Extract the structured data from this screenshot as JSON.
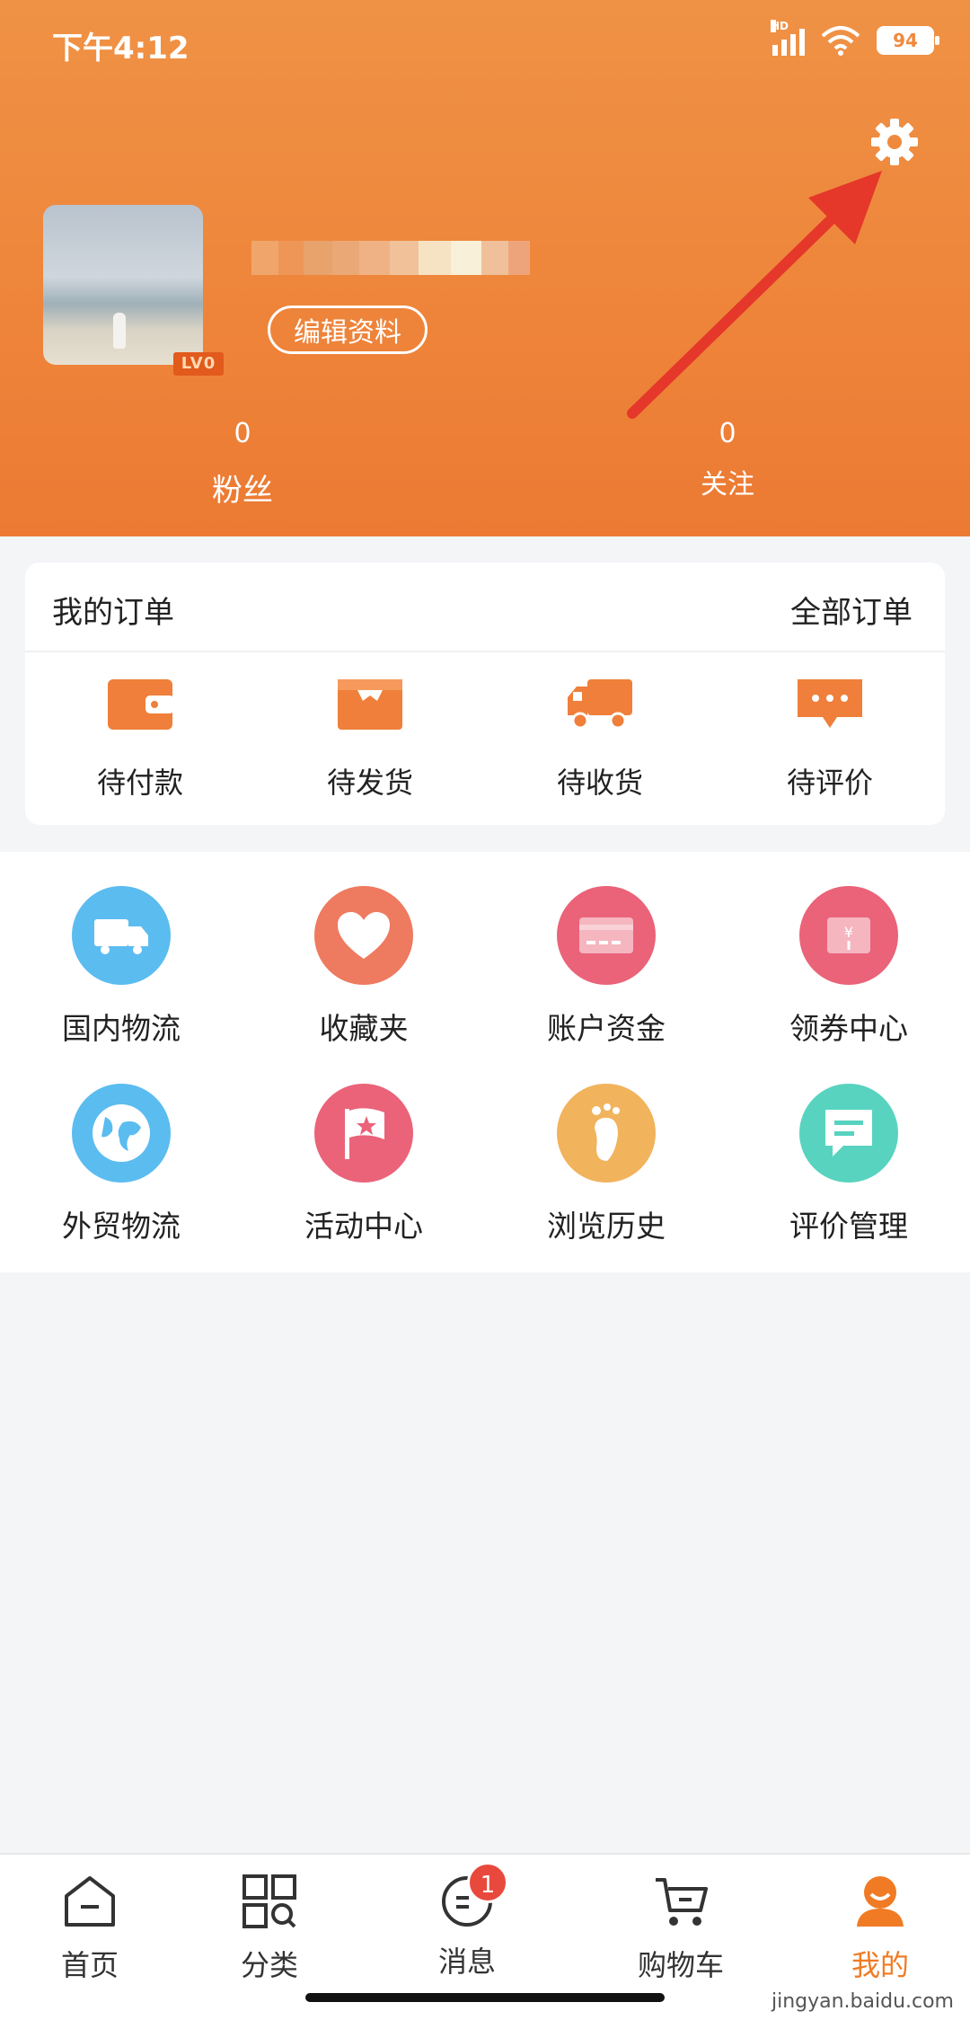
{
  "status_bar": {
    "time": "下午4:12",
    "network": "HD",
    "battery": "94"
  },
  "profile": {
    "edit_label": "编辑资料",
    "level": "LV0"
  },
  "stats": {
    "fans": {
      "count": "0",
      "label": "粉丝"
    },
    "follow": {
      "count": "0",
      "label": "关注"
    }
  },
  "orders": {
    "title": "我的订单",
    "all_label": "全部订单",
    "items": [
      {
        "label": "待付款",
        "icon": "wallet-icon"
      },
      {
        "label": "待发货",
        "icon": "box-icon"
      },
      {
        "label": "待收货",
        "icon": "truck-icon"
      },
      {
        "label": "待评价",
        "icon": "comment-icon"
      }
    ]
  },
  "services": [
    {
      "label": "国内物流",
      "icon": "truck-icon",
      "color": "#5bbcf0"
    },
    {
      "label": "收藏夹",
      "icon": "heart-icon",
      "color": "#ee7a5f"
    },
    {
      "label": "账户资金",
      "icon": "card-icon",
      "color": "#ea6379"
    },
    {
      "label": "领券中心",
      "icon": "coupon-icon",
      "color": "#ea6379"
    },
    {
      "label": "外贸物流",
      "icon": "globe-icon",
      "color": "#5bbcf0"
    },
    {
      "label": "活动中心",
      "icon": "flag-icon",
      "color": "#ea6379"
    },
    {
      "label": "浏览历史",
      "icon": "footprint-icon",
      "color": "#f1b35c"
    },
    {
      "label": "评价管理",
      "icon": "message-icon",
      "color": "#58d3bf"
    }
  ],
  "nav": {
    "items": [
      {
        "label": "首页",
        "icon": "home-icon"
      },
      {
        "label": "分类",
        "icon": "category-icon"
      },
      {
        "label": "消息",
        "icon": "message-icon",
        "badge": "1"
      },
      {
        "label": "购物车",
        "icon": "cart-icon"
      },
      {
        "label": "我的",
        "icon": "user-icon"
      }
    ]
  },
  "watermark": "jingyan.baidu.com",
  "colors": {
    "accent": "#f07b24",
    "header": "#ee843a",
    "badge": "#e8493c"
  }
}
